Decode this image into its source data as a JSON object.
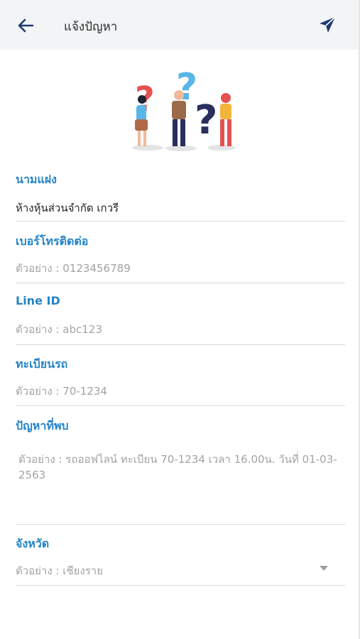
{
  "header": {
    "title": "แจ้งปัญหา",
    "back_icon": "arrow-left-icon",
    "send_icon": "send-icon"
  },
  "hero": {
    "icon": "question-people-illustration"
  },
  "form": {
    "shop_name": {
      "label": "นามแฝง",
      "value": "ห้างหุ้นส่วนจำกัด เกวรี"
    },
    "phone": {
      "label": "เบอร์โทรติดต่อ",
      "placeholder": "ตัวอย่าง : 0123456789"
    },
    "line_id": {
      "label": "Line ID",
      "placeholder": "ตัวอย่าง : abc123"
    },
    "plate": {
      "label": "ทะเบียนรถ",
      "placeholder": "ตัวอย่าง : 70-1234"
    },
    "problem": {
      "label": "ปัญหาที่พบ",
      "placeholder": "ตัวอย่าง : รถออฟไลน์ ทะเบียน 70-1234 เวลา 16.00น. วันที่ 01-03-2563"
    },
    "province": {
      "label": "จังหวัด",
      "placeholder": "ตัวอย่าง : เชียงราย"
    }
  },
  "colors": {
    "accent": "#2584c8",
    "header_bg": "#f3f4f6",
    "icon": "#1f3a73"
  }
}
